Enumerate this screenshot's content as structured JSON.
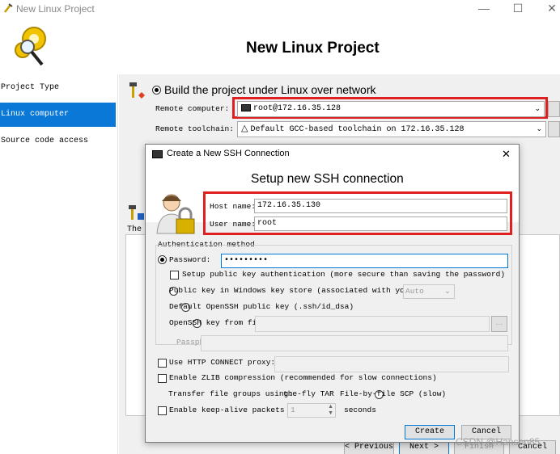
{
  "window": {
    "title": "New Linux Project",
    "heading": "New Linux Project",
    "minimize": "—",
    "maximize": "☐",
    "close": "✕"
  },
  "sidebar": {
    "items": [
      {
        "label": "Project Type",
        "active": false
      },
      {
        "label": "Linux computer selection",
        "active": true
      },
      {
        "label": "Source code access",
        "active": false
      }
    ]
  },
  "main": {
    "build_option": "Build the project under Linux over network",
    "remote_computer_label": "Remote computer:",
    "remote_computer_value": "root@172.16.35.128",
    "remote_toolchain_label": "Remote toolchain:",
    "remote_toolchain_value": "Default GCC-based toolchain on 172.16.35.128",
    "partial_text": "The s",
    "previous_button": "< Previous",
    "next_button": "Next >",
    "finish_button": "Finish",
    "cancel_button": "Cancel"
  },
  "dialog": {
    "title": "Create a New SSH Connection",
    "heading": "Setup new SSH connection",
    "close": "✕",
    "host_name_label": "Host name:",
    "host_name_value": "172.16.35.130",
    "user_name_label": "User name:",
    "user_name_value": "root",
    "auth_group_label": "Authentication method",
    "password_label": "Password:",
    "password_value": "•••••••••",
    "setup_pubkey_label": "Setup public key authentication (more secure than saving the password)",
    "pubkey_windows_label": "Public key in Windows key store (associated with your us",
    "pubkey_windows_select": "Auto",
    "default_openssh_label": "Default OpenSSH public key (.ssh/id_dsa)",
    "openssh_file_label": "OpenSSH key from file:",
    "passphrase_label": "Passphrase:",
    "http_proxy_label": "Use HTTP CONNECT proxy:",
    "zlib_label": "Enable ZLIB compression (recommended for slow connections)",
    "transfer_label": "Transfer file groups using:",
    "transfer_opt1": "the-fly TAR",
    "transfer_opt2": "File-by-file SCP (slow)",
    "keepalive_label": "Enable keep-alive packets eve",
    "keepalive_value": "1",
    "seconds_label": "seconds",
    "create_button": "Create",
    "cancel_button": "Cancel",
    "browse_button": "..."
  },
  "watermark": "CSDN @Hanson85",
  "colors": {
    "accent": "#0a78d7",
    "highlight_box": "#e02020"
  }
}
